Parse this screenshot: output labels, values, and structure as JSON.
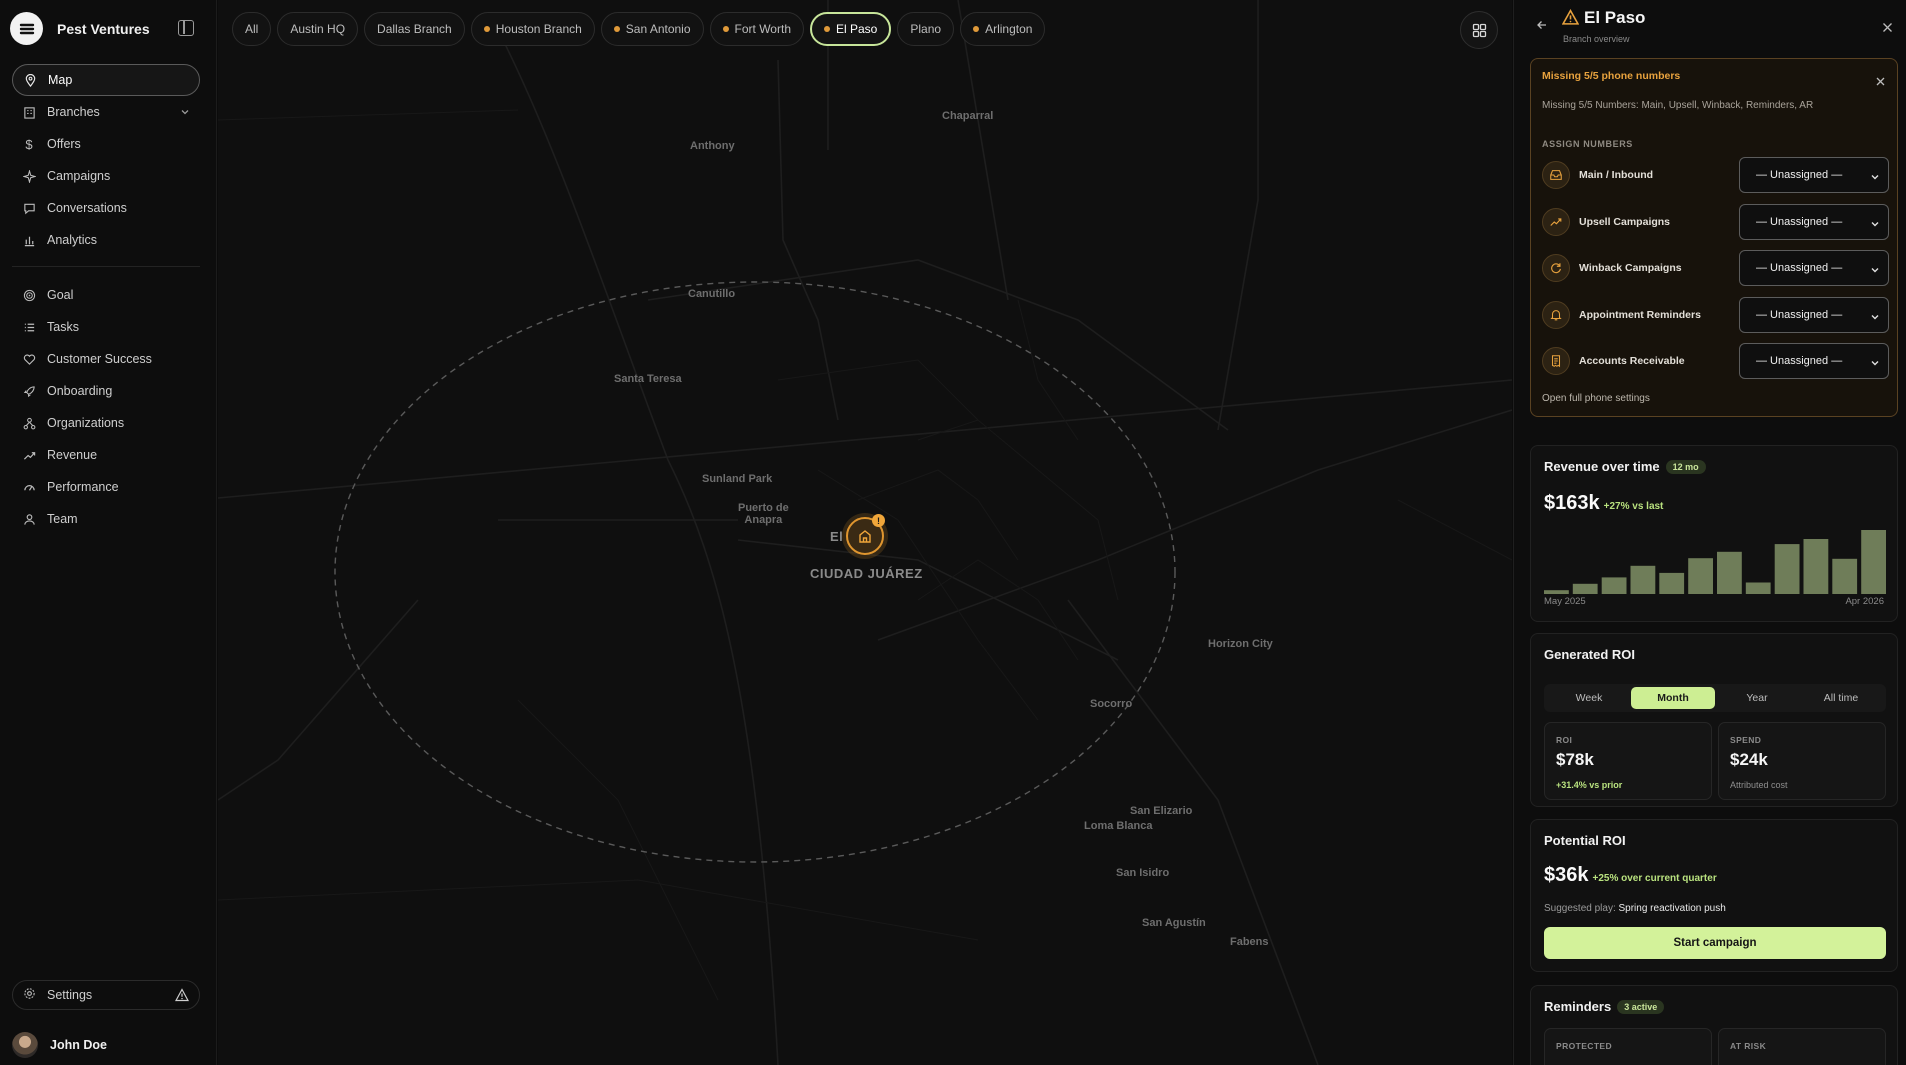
{
  "brand": {
    "name": "Pest Ventures"
  },
  "nav": {
    "primary": [
      {
        "label": "Map",
        "icon": "map-pin-icon",
        "active": true
      },
      {
        "label": "Branches",
        "icon": "building-icon",
        "has_chevron": true
      },
      {
        "label": "Offers",
        "icon": "dollar-icon"
      },
      {
        "label": "Campaigns",
        "icon": "sparkle-icon"
      },
      {
        "label": "Conversations",
        "icon": "message-icon"
      },
      {
        "label": "Analytics",
        "icon": "bar-chart-icon"
      }
    ],
    "secondary": [
      {
        "label": "Goal",
        "icon": "target-icon"
      },
      {
        "label": "Tasks",
        "icon": "list-icon"
      },
      {
        "label": "Customer Success",
        "icon": "heart-icon"
      },
      {
        "label": "Onboarding",
        "icon": "rocket-icon"
      },
      {
        "label": "Organizations",
        "icon": "org-icon"
      },
      {
        "label": "Revenue",
        "icon": "trend-icon"
      },
      {
        "label": "Performance",
        "icon": "gauge-icon"
      },
      {
        "label": "Team",
        "icon": "user-icon"
      }
    ],
    "settings": "Settings",
    "user": "John Doe"
  },
  "branch_chips": [
    {
      "label": "All",
      "dot": false,
      "active": false
    },
    {
      "label": "Austin HQ",
      "dot": false,
      "active": false
    },
    {
      "label": "Dallas Branch",
      "dot": false,
      "active": false
    },
    {
      "label": "Houston Branch",
      "dot": true,
      "active": false
    },
    {
      "label": "San Antonio",
      "dot": true,
      "active": false
    },
    {
      "label": "Fort Worth",
      "dot": true,
      "active": false
    },
    {
      "label": "El Paso",
      "dot": true,
      "active": true
    },
    {
      "label": "Plano",
      "dot": false,
      "active": false
    },
    {
      "label": "Arlington",
      "dot": true,
      "active": false
    }
  ],
  "map_labels": {
    "chaparral": "Chaparral",
    "anthony": "Anthony",
    "canutillo": "Canutillo",
    "santa_teresa": "Santa Teresa",
    "sunland_park": "Sunland Park",
    "puerto_de_anapra": "Puerto de\nAnapra",
    "el_paso": "El Paso",
    "ciudad_juarez": "CIUDAD JUÁREZ",
    "horizon_city": "Horizon City",
    "socorro": "Socorro",
    "san_elizario": "San Elizario",
    "loma_blanca": "Loma Blanca",
    "san_isidro": "San Isidro",
    "san_agustin": "San Agustín",
    "fabens": "Fabens"
  },
  "marker_badge": "!",
  "panel": {
    "title": "El Paso",
    "subtitle": "Branch overview",
    "alert": {
      "title": "Missing 5/5 phone numbers",
      "description": "Missing 5/5 Numbers: Main, Upsell, Winback, Reminders, AR",
      "assign_heading": "ASSIGN NUMBERS",
      "rows": [
        {
          "label": "Main / Inbound",
          "icon": "inbox-icon",
          "value": "— Unassigned —"
        },
        {
          "label": "Upsell Campaigns",
          "icon": "trend-up-icon",
          "value": "— Unassigned —"
        },
        {
          "label": "Winback Campaigns",
          "icon": "refresh-icon",
          "value": "— Unassigned —"
        },
        {
          "label": "Appointment Reminders",
          "icon": "bell-icon",
          "value": "— Unassigned —"
        },
        {
          "label": "Accounts Receivable",
          "icon": "receipt-icon",
          "value": "— Unassigned —"
        }
      ],
      "link": "Open full phone settings"
    },
    "revenue": {
      "title": "Revenue over time",
      "badge": "12 mo",
      "value": "$163k",
      "delta": "+27% vs last",
      "start_label": "May 2025",
      "end_label": "Apr 2026"
    },
    "roi": {
      "title": "Generated ROI",
      "tabs": [
        "Week",
        "Month",
        "Year",
        "All time"
      ],
      "active_tab": "Month",
      "roi_key": "ROI",
      "roi_value": "$78k",
      "roi_sub": "+31.4% vs prior",
      "spend_key": "SPEND",
      "spend_value": "$24k",
      "spend_sub": "Attributed cost"
    },
    "potential": {
      "title": "Potential ROI",
      "value": "$36k",
      "delta": "+25% over current quarter",
      "suggest_label": "Suggested play:",
      "suggest_value": "Spring reactivation push",
      "cta": "Start campaign"
    },
    "reminders": {
      "title": "Reminders",
      "badge": "3 active",
      "protected_key": "PROTECTED",
      "at_risk_key": "AT RISK"
    }
  },
  "chart_data": {
    "type": "bar",
    "title": "Revenue over time",
    "categories": [
      "May 2025",
      "",
      "",
      "",
      "",
      "",
      "",
      "",
      "",
      "",
      "",
      "Apr 2026"
    ],
    "values": [
      0.06,
      0.16,
      0.26,
      0.44,
      0.33,
      0.56,
      0.66,
      0.18,
      0.78,
      0.86,
      0.55,
      1.0
    ],
    "value_units": "fraction of tallest bar"
  },
  "colors": {
    "accent": "#cdee93",
    "warning": "#e8a23e",
    "panel_bg": "#0d0d0d",
    "bar": "#6f7d59"
  }
}
